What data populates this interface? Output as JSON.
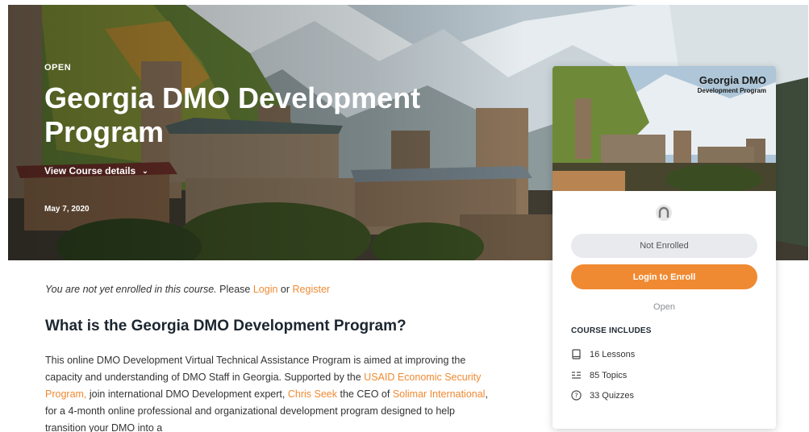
{
  "hero": {
    "status": "OPEN",
    "title": "Georgia DMO Development Program",
    "details_link": "View Course details",
    "date": "May 7, 2020"
  },
  "card": {
    "thumb_title": "Georgia DMO",
    "thumb_subtitle": "Development Program",
    "enrollment_status": "Not Enrolled",
    "enroll_button": "Login to Enroll",
    "course_status": "Open",
    "includes_heading": "COURSE INCLUDES",
    "includes": [
      {
        "icon": "book-icon",
        "label": "16 Lessons"
      },
      {
        "icon": "list-icon",
        "label": "85 Topics"
      },
      {
        "icon": "question-circle-icon",
        "label": "33 Quizzes"
      }
    ]
  },
  "notice": {
    "text_italic": "You are not yet enrolled in this course.",
    "text_please": "Please",
    "login_link": "Login",
    "or_text": "or",
    "register_link": "Register"
  },
  "section": {
    "title": "What is the Georgia DMO Development Program?"
  },
  "description": {
    "p1": "This online DMO Development Virtual Technical Assistance Program is aimed at improving the capacity and understanding of DMO Staff in Georgia. Supported by the",
    "link1": "USAID Economic Security Program,",
    "p2": "join international DMO Development expert,",
    "link2": "Chris Seek",
    "p3": "the CEO of",
    "link3": "Solimar International",
    "p4": ", for a 4-month online professional and organizational development program designed to help transition your DMO into a"
  },
  "colors": {
    "accent": "#f08a32",
    "pill_bg": "#e8eaee",
    "heading": "#1b2630"
  }
}
